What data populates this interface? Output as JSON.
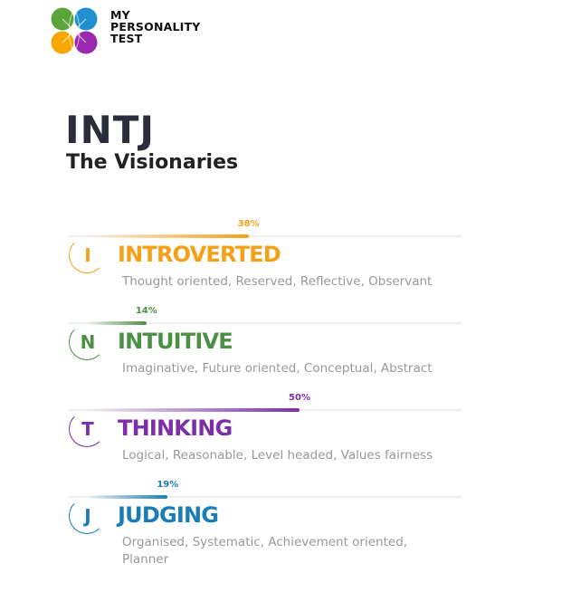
{
  "brand": {
    "name_lines": [
      "MY",
      "PERSONALITY",
      "TEST"
    ],
    "colors": [
      "#5aa43a",
      "#1f8fcf",
      "#f7a600",
      "#9c27b0"
    ]
  },
  "result": {
    "code": "INTJ",
    "name": "The Visionaries"
  },
  "traits": [
    {
      "letter": "I",
      "title": "INTROVERTED",
      "percent_label": "38%",
      "percent": 38,
      "description": "Thought oriented, Reserved, Reflective, Observant",
      "color": "#f5a019"
    },
    {
      "letter": "N",
      "title": "INTUITIVE",
      "percent_label": "14%",
      "percent": 14,
      "description": "Imaginative, Future oriented, Conceptual, Abstract",
      "color": "#4c9046"
    },
    {
      "letter": "T",
      "title": "THINKING",
      "percent_label": "50%",
      "percent": 50,
      "description": "Logical, Reasonable, Level headed, Values fairness",
      "color": "#7b2fa8"
    },
    {
      "letter": "J",
      "title": "JUDGING",
      "percent_label": "19%",
      "percent": 19,
      "description": "Organised, Systematic, Achievement oriented, Planner",
      "color": "#1a7db8"
    }
  ]
}
